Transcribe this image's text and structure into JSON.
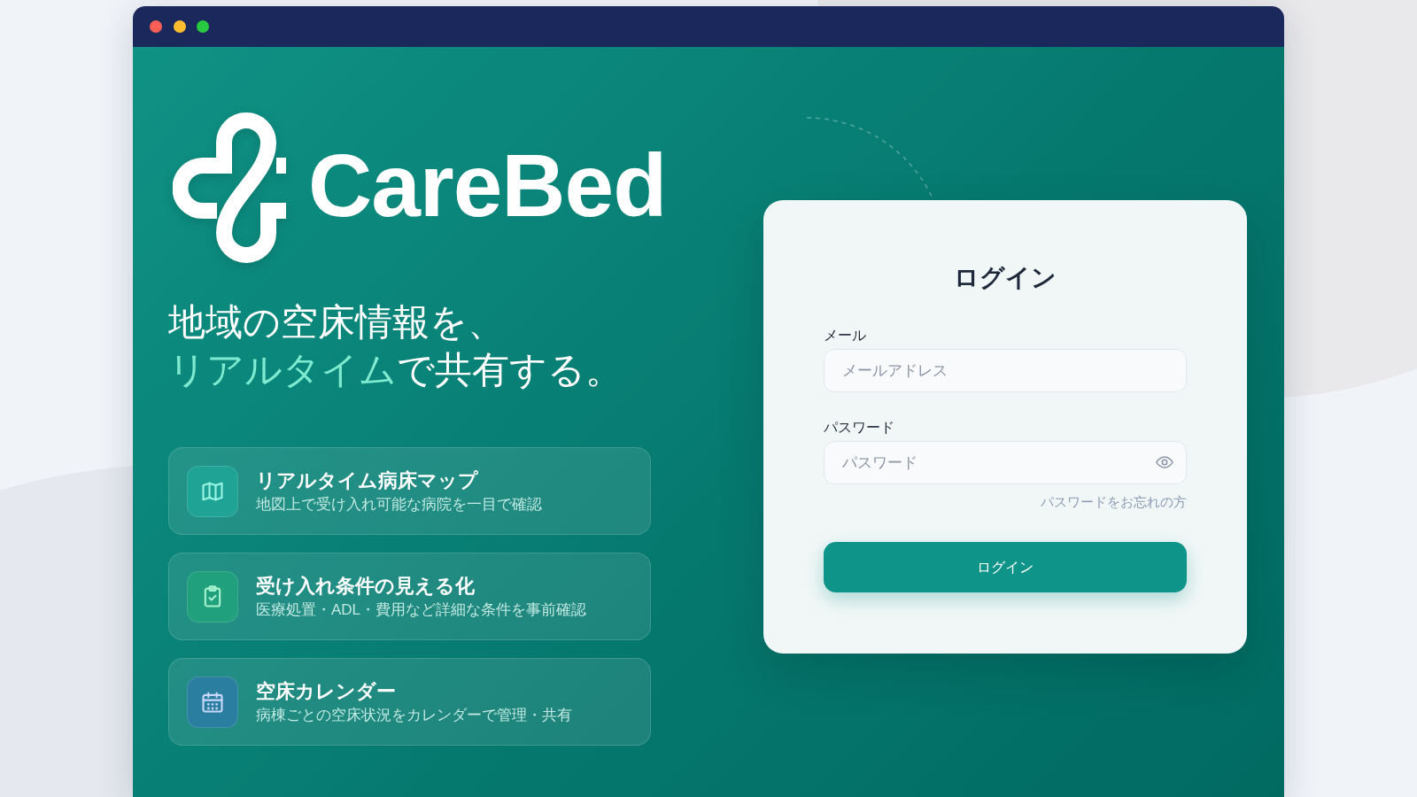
{
  "window": {
    "controls": [
      {
        "color": "#ff5f57"
      },
      {
        "color": "#febc2e"
      },
      {
        "color": "#28c840"
      }
    ]
  },
  "brand": {
    "name": "CareBed"
  },
  "tagline": {
    "lines": [
      {
        "segments": [
          {
            "text": "地域の空床情報を、",
            "highlight": false
          }
        ]
      },
      {
        "segments": [
          {
            "text": "リアルタイム",
            "highlight": true
          },
          {
            "text": "で共有する。",
            "highlight": false
          }
        ]
      }
    ]
  },
  "features": [
    {
      "kind": "map",
      "color": "#1fa394",
      "title": "リアルタイム病床マップ",
      "description": "地図上で受け入れ可能な病院を一目で確認"
    },
    {
      "kind": "clipboard",
      "color": "#20a07c",
      "title": "受け入れ条件の見える化",
      "description": "医療処置・ADL・費用など詳細な条件を事前確認"
    },
    {
      "kind": "calendar",
      "color": "#2a7e9f",
      "title": "空床カレンダー",
      "description": "病棟ごとの空床状況をカレンダーで管理・共有"
    }
  ],
  "login": {
    "title": "ログイン",
    "fields": [
      {
        "kind": "email",
        "label": "メール",
        "placeholder": "メールアドレス"
      },
      {
        "kind": "password",
        "label": "パスワード",
        "placeholder": "パスワード"
      }
    ],
    "forgot_link": "パスワードをお忘れの方",
    "submit": "ログイン"
  }
}
